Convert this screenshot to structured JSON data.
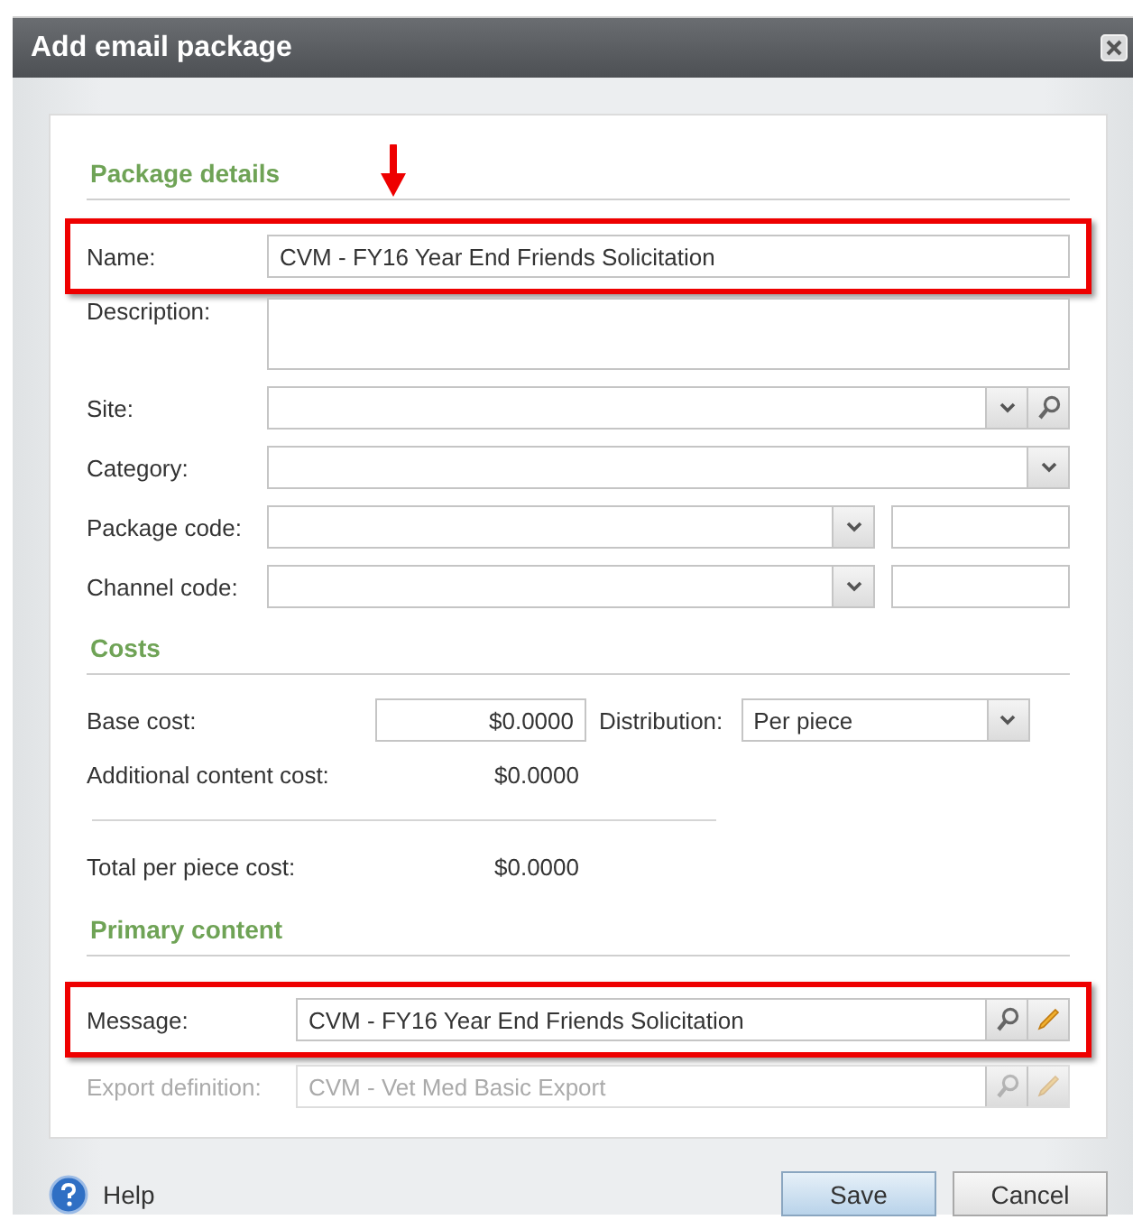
{
  "window": {
    "title": "Add email package"
  },
  "package_details": {
    "heading": "Package details",
    "fields": [
      {
        "kind": "text",
        "label": "Name:",
        "value": "CVM - FY16 Year End Friends Solicitation",
        "highlighted": true,
        "pointer_arrow": true
      },
      {
        "kind": "textarea",
        "label": "Description:",
        "highlighted": false,
        "pointer_arrow": false
      },
      {
        "kind": "search_dropdown",
        "label": "Site:",
        "highlighted": false,
        "pointer_arrow": false
      },
      {
        "kind": "dropdown",
        "label": "Category:",
        "highlighted": false,
        "pointer_arrow": false
      },
      {
        "kind": "code_dropdown",
        "label": "Package code:",
        "highlighted": false,
        "pointer_arrow": false
      },
      {
        "kind": "code_dropdown",
        "label": "Channel code:",
        "highlighted": false,
        "pointer_arrow": false
      }
    ]
  },
  "costs": {
    "heading": "Costs",
    "base_cost": {
      "label": "Base cost:",
      "value": "$0.0000"
    },
    "distribution": {
      "label": "Distribution:",
      "value": "Per piece"
    },
    "additional_content_cost": {
      "label": "Additional content cost:",
      "value": "$0.0000"
    },
    "total_per_piece_cost": {
      "label": "Total per piece cost:",
      "value": "$0.0000"
    }
  },
  "primary_content": {
    "heading": "Primary content",
    "fields": [
      {
        "kind": "lookup",
        "label": "Message:",
        "value": "CVM - FY16 Year End Friends Solicitation",
        "highlighted": true,
        "disabled": false
      },
      {
        "kind": "lookup",
        "label": "Export definition:",
        "value": "CVM - Vet Med Basic Export",
        "highlighted": false,
        "disabled": true
      }
    ]
  },
  "footer": {
    "help": "Help",
    "buttons": [
      {
        "label": "Save",
        "kind": "primary"
      },
      {
        "label": "Cancel",
        "kind": "secondary"
      }
    ]
  }
}
